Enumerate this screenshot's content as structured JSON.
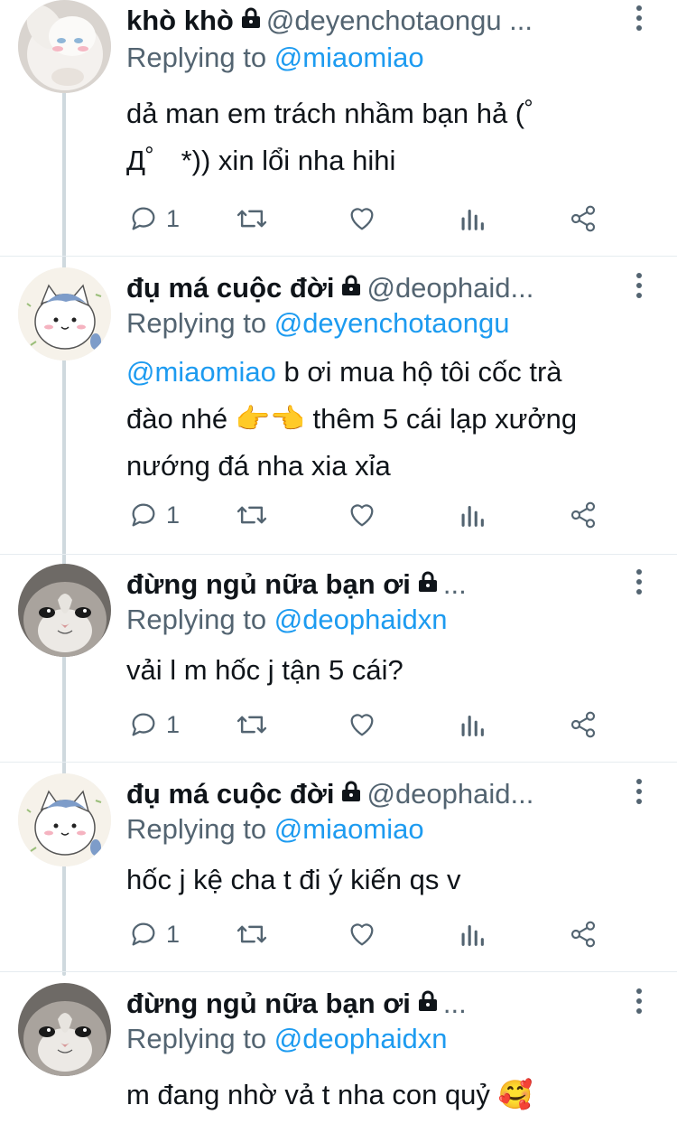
{
  "colors": {
    "accent": "#1d9bf0",
    "text": "#0f1419",
    "muted": "#536471",
    "thread": "#cfd9de"
  },
  "tweets": [
    {
      "avatar": "plush-bunny-avatar",
      "name": "khò khò",
      "handle": "@deyenchotaongu ...",
      "reply_prefix": "Replying to",
      "reply_to": "@miaomiao",
      "body_mention": "",
      "body_lines": [
        "dả man em trách nhầm bạn hả (゜",
        "Д゜ *)) xin lổi nha hihi"
      ],
      "reply_count": "1"
    },
    {
      "avatar": "white-cat-cartoon-avatar",
      "name": "đụ má cuộc đời",
      "handle": "@deophaid...",
      "reply_prefix": "Replying to",
      "reply_to": "@deyenchotaongu",
      "body_mention": "@miaomiao",
      "body_lines": [
        " b ơi mua hộ tôi cốc trà",
        "đào nhé 👉👈 thêm 5 cái lạp xưởng",
        "nướng đá nha xia xỉa"
      ],
      "reply_count": "1"
    },
    {
      "avatar": "grey-cat-photo-avatar",
      "name": "đừng ngủ nữa bạn ơi",
      "handle": "...",
      "reply_prefix": "Replying to",
      "reply_to": "@deophaidxn",
      "body_mention": "",
      "body_lines": [
        "vải l m hốc j tận 5 cái?"
      ],
      "reply_count": "1"
    },
    {
      "avatar": "white-cat-cartoon-avatar",
      "name": "đụ má cuộc đời",
      "handle": "@deophaid...",
      "reply_prefix": "Replying to",
      "reply_to": "@miaomiao",
      "body_mention": "",
      "body_lines": [
        "hốc j kệ cha t đi ý kiến qs v"
      ],
      "reply_count": "1"
    },
    {
      "avatar": "grey-cat-photo-avatar",
      "name": "đừng ngủ nữa bạn ơi",
      "handle": "...",
      "reply_prefix": "Replying to",
      "reply_to": "@deophaidxn",
      "body_mention": "",
      "body_lines": [
        "m đang nhờ vả t nha con quỷ 🥰"
      ],
      "reply_count": ""
    }
  ]
}
